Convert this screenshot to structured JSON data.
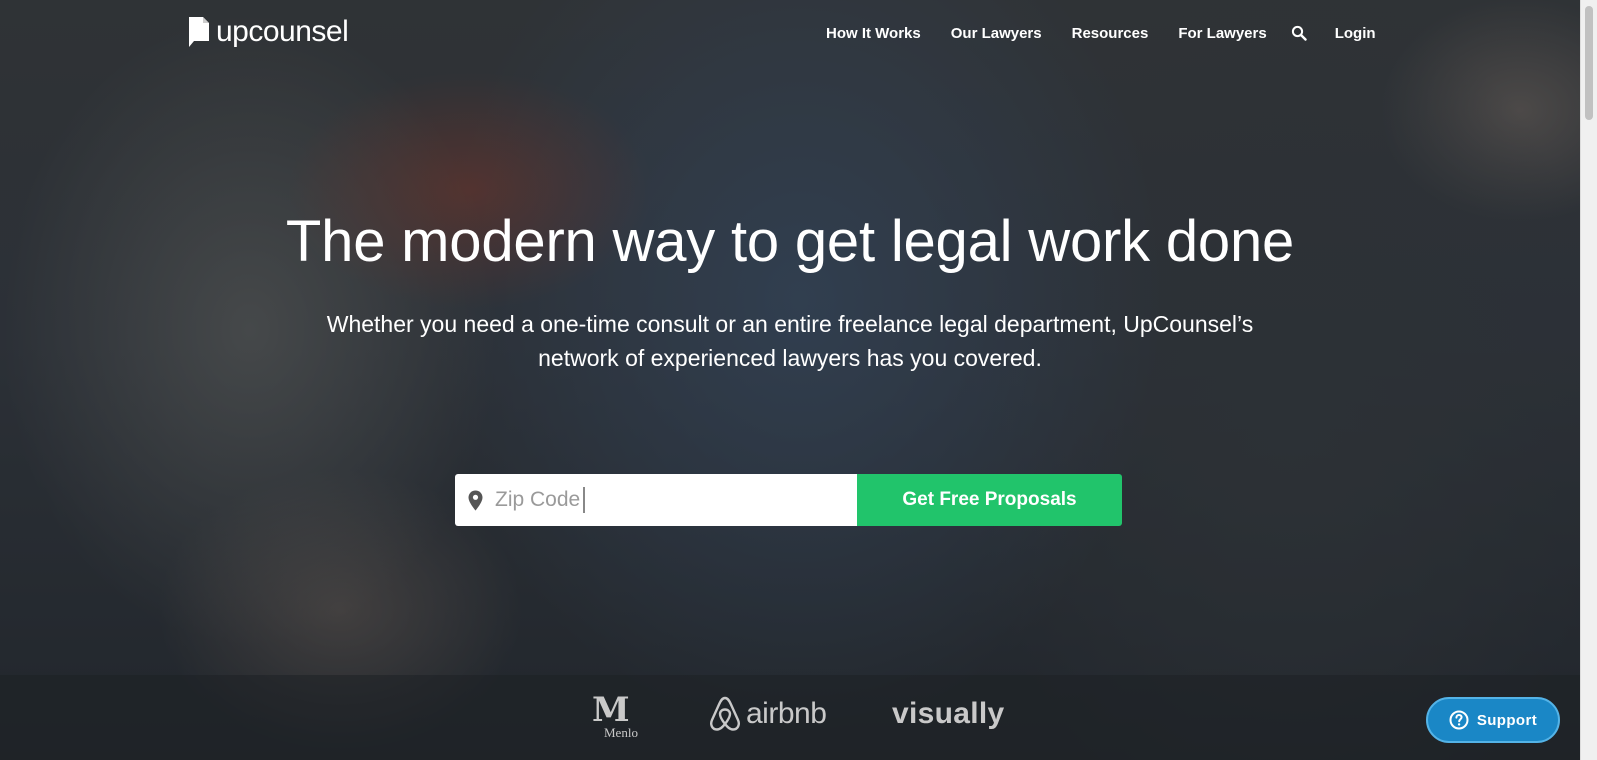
{
  "brand": {
    "name": "upcounsel",
    "icon": "document-flag-icon"
  },
  "nav": {
    "items": [
      {
        "label": "How It Works"
      },
      {
        "label": "Our Lawyers"
      },
      {
        "label": "Resources"
      },
      {
        "label": "For Lawyers"
      }
    ],
    "search_icon": "search-icon",
    "login_label": "Login"
  },
  "hero": {
    "title": "The modern way to get legal work done",
    "subtitle": "Whether you need a one-time consult or an entire freelance legal department, UpCounsel’s network of experienced lawyers has you covered."
  },
  "form": {
    "zip_placeholder": "Zip Code",
    "zip_value": "",
    "cta_label": "Get Free Proposals",
    "accent_color": "#21c46b"
  },
  "logos": {
    "menlo_mark": "M",
    "menlo_text": "Menlo",
    "airbnb": "airbnb",
    "visually": "visually"
  },
  "support": {
    "label": "Support",
    "icon": "help-icon",
    "color": "#1a87c6"
  }
}
